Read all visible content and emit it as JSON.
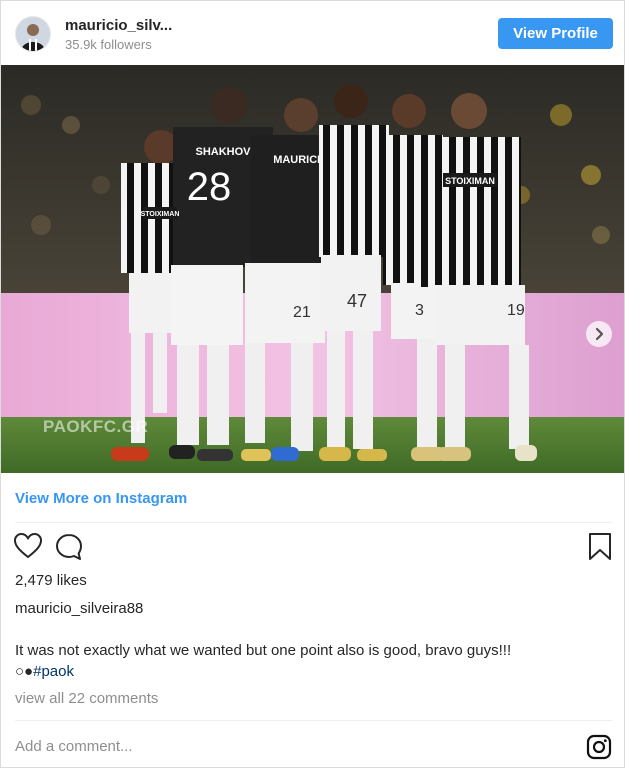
{
  "header": {
    "username": "mauricio_silv...",
    "followers": "35.9k followers",
    "view_profile_label": "View Profile"
  },
  "photo": {
    "watermark": "PAOKFC.GR",
    "jersey_names": [
      "SHAKHOV",
      "MAURICIO",
      "STOIXIMAN",
      "STOIXIMAN"
    ],
    "jersey_numbers": [
      "28",
      "21",
      "47",
      "3",
      "19"
    ]
  },
  "links": {
    "view_more": "View More on Instagram"
  },
  "actions": {
    "like_icon": "heart-icon",
    "comment_icon": "comment-icon",
    "save_icon": "bookmark-icon"
  },
  "post": {
    "likes": "2,479 likes",
    "author": "mauricio_silveira88",
    "caption": "It was not exactly what we wanted but one point also is good, bravo guys!!!",
    "tags_emoji": "○●",
    "hashtag": "#paok",
    "view_comments": "view all 22 comments"
  },
  "comment_box": {
    "placeholder": "Add a comment...",
    "instagram_icon": "instagram-icon"
  },
  "colors": {
    "accent": "#3897f0",
    "text": "#262626",
    "muted": "#8e8e8e",
    "hashtag": "#003569"
  }
}
